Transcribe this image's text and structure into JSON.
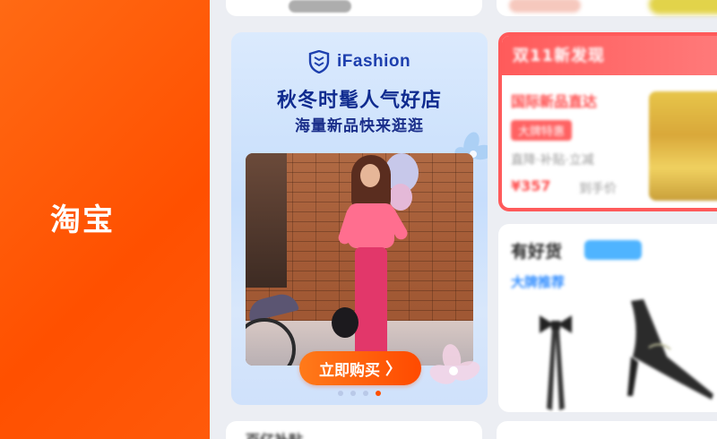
{
  "brand": {
    "name": "淘宝",
    "color": "#ff5000"
  },
  "promo": {
    "logo_text": "iFashion",
    "title": "秋冬时髦人气好店",
    "subtitle": "海量新品快来逛逛",
    "button_label": "立即购买",
    "carousel": {
      "count": 4,
      "active_index": 3
    }
  },
  "red_card": {
    "header": "双11新发现",
    "tag": "国际新品直达",
    "chip": "大牌特惠",
    "line": "直降·补贴·立减",
    "price": "¥357",
    "price_note": "到手价"
  },
  "good_card": {
    "title": "有好货",
    "subtitle": "大牌推荐"
  },
  "bottom_card": {
    "title": "百亿补贴"
  }
}
